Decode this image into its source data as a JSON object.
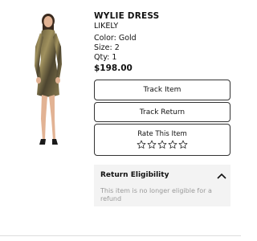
{
  "product": {
    "title": "WYLIE DRESS",
    "brand": "LIKELY",
    "color": "Color: Gold",
    "size": "Size: 2",
    "qty": "Qty: 1",
    "price": "$198.00",
    "image_icon": "model-in-gold-dress"
  },
  "actions": {
    "track_item": "Track Item",
    "track_return": "Track Return"
  },
  "rating": {
    "label": "Rate This Item",
    "stars": 5,
    "value": 0
  },
  "eligibility": {
    "title": "Return Eligibility",
    "message": "This item is no longer eligible for a refund",
    "toggle_icon": "chevron-up-icon",
    "expanded": true
  }
}
